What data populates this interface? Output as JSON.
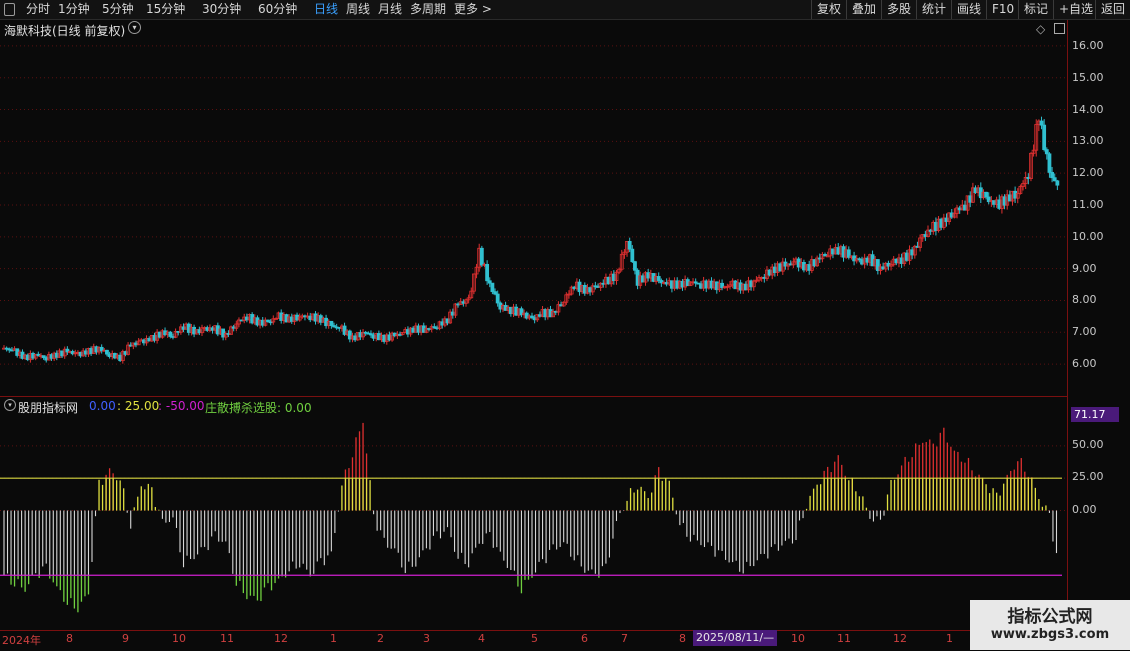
{
  "toolbar": {
    "periods": [
      "分时",
      "1分钟",
      "5分钟",
      "15分钟",
      "30分钟",
      "60分钟",
      "日线",
      "周线",
      "月线",
      "多周期",
      "更多 >"
    ],
    "active_period": "日线",
    "right_buttons": [
      "复权",
      "叠加",
      "多股",
      "统计",
      "画线",
      "F10",
      "标记",
      "+自选",
      "返回"
    ]
  },
  "main_panel": {
    "title": "海默科技(日线 前复权)",
    "icon_labels": [
      "◇"
    ]
  },
  "indicator_panel": {
    "name": "股朋指标网",
    "v1": "0.00",
    "v2": ": 25.00",
    "v3": ": -50.00",
    "signal_label": "庄散搏杀选股: 0.00"
  },
  "right_axis": {
    "price_ticks": [
      "16.00",
      "15.00",
      "14.00",
      "13.00",
      "12.00",
      "11.00",
      "10.00",
      "9.00",
      "8.00",
      "7.00",
      "6.00"
    ],
    "indicator_ticks": [
      "50.00",
      "25.00",
      "0.00"
    ],
    "highlight": "71.17"
  },
  "bottom_axis": {
    "labels": [
      "2024年",
      "8",
      "9",
      "10",
      "11",
      "12",
      "1",
      "2",
      "3",
      "4",
      "5",
      "6",
      "7",
      "8",
      "10",
      "11",
      "12",
      "1"
    ],
    "date_tip": "2025/08/11/—"
  },
  "watermark": {
    "line1": "指标公式网",
    "line2": "www.zbgs3.com"
  },
  "colors": {
    "up": "#e03030",
    "down": "#30c0d0",
    "line_yellow": "#d8d840",
    "line_magenta": "#d020d0",
    "bar_green": "#70d040",
    "bar_white": "#d8d8d8",
    "bar_red": "#e03030",
    "bar_yellow": "#e0e040",
    "grid": "#7a1010"
  },
  "chart_data": {
    "type": "line",
    "price_series": [
      6.5,
      6.4,
      6.2,
      6.3,
      6.2,
      6.3,
      6.4,
      6.3,
      6.4,
      6.5,
      6.3,
      6.2,
      6.6,
      6.7,
      6.8,
      7.0,
      6.9,
      7.2,
      7.0,
      7.1,
      7.1,
      6.9,
      7.3,
      7.5,
      7.3,
      7.3,
      7.5,
      7.4,
      7.5,
      7.5,
      7.4,
      7.2,
      7.1,
      6.8,
      7.0,
      6.9,
      6.8,
      6.9,
      7.0,
      7.1,
      7.1,
      7.2,
      7.4,
      7.9,
      8.0,
      9.5,
      8.5,
      7.8,
      7.7,
      7.6,
      7.4,
      7.6,
      7.6,
      8.0,
      8.5,
      8.3,
      8.4,
      8.6,
      8.8,
      9.9,
      8.6,
      8.8,
      8.6,
      8.5,
      8.5,
      8.6,
      8.5,
      8.5,
      8.4,
      8.5,
      8.4,
      8.6,
      8.8,
      9.0,
      9.1,
      9.2,
      9.0,
      9.3,
      9.5,
      9.6,
      9.4,
      9.2,
      9.3,
      9.0,
      9.2,
      9.3,
      9.5,
      10.0,
      10.3,
      10.5,
      10.8,
      11.0,
      11.5,
      11.2,
      11.0,
      11.2,
      11.4,
      12.0,
      13.8,
      12.0,
      11.5
    ],
    "indicator_series": [
      -50,
      -55,
      -60,
      -50,
      -45,
      -60,
      -70,
      -75,
      -65,
      20,
      30,
      25,
      -10,
      20,
      15,
      -10,
      -5,
      -40,
      -35,
      -30,
      -20,
      -25,
      -55,
      -65,
      -70,
      -60,
      -55,
      -45,
      -40,
      -50,
      -40,
      -35,
      20,
      45,
      70,
      -5,
      -25,
      -30,
      -45,
      -40,
      -30,
      -20,
      -15,
      -35,
      -40,
      -25,
      -20,
      -35,
      -45,
      -60,
      -50,
      -40,
      -30,
      -25,
      -35,
      -45,
      -50,
      -45,
      -10,
      10,
      20,
      10,
      30,
      20,
      -10,
      -20,
      -25,
      -30,
      -35,
      -40,
      -45,
      -40,
      -35,
      -30,
      -25,
      -20,
      5,
      20,
      30,
      40,
      25,
      15,
      -5,
      -10,
      20,
      35,
      45,
      55,
      50,
      60,
      45,
      40,
      30,
      20,
      10,
      25,
      40,
      30,
      10,
      -5,
      -50
    ],
    "ref_lines": [
      25,
      -50
    ],
    "ylim_price": [
      5.5,
      16.5
    ],
    "ylim_indicator": [
      -90,
      80
    ]
  }
}
